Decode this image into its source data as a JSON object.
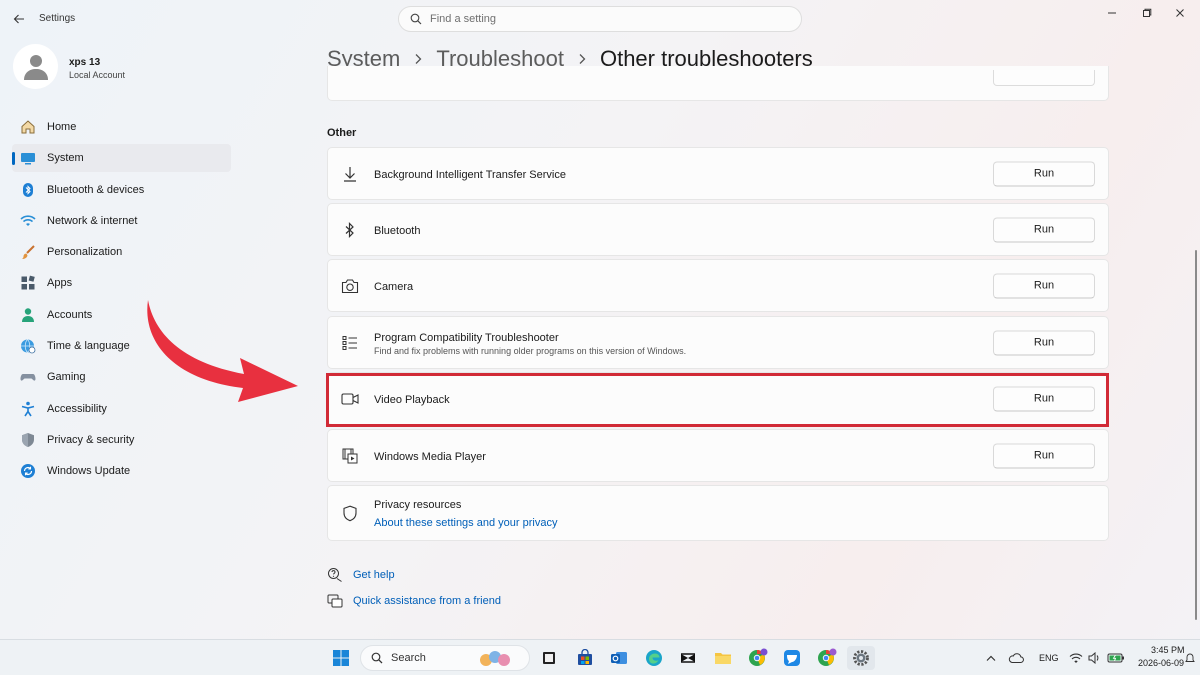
{
  "window": {
    "title": "Settings",
    "controls": [
      "minimize-icon",
      "maximize-icon",
      "close-icon"
    ]
  },
  "search": {
    "placeholder": "Find a setting"
  },
  "profile": {
    "name": "xps 13",
    "account_type": "Local Account"
  },
  "sidebar": {
    "items": [
      {
        "label": "Home",
        "icon": "home-icon"
      },
      {
        "label": "System",
        "icon": "system-icon",
        "active": true
      },
      {
        "label": "Bluetooth & devices",
        "icon": "bluetooth-devices-icon"
      },
      {
        "label": "Network & internet",
        "icon": "wifi-icon"
      },
      {
        "label": "Personalization",
        "icon": "brush-icon"
      },
      {
        "label": "Apps",
        "icon": "apps-icon"
      },
      {
        "label": "Accounts",
        "icon": "accounts-icon"
      },
      {
        "label": "Time & language",
        "icon": "globe-clock-icon"
      },
      {
        "label": "Gaming",
        "icon": "controller-icon"
      },
      {
        "label": "Accessibility",
        "icon": "accessibility-icon"
      },
      {
        "label": "Privacy & security",
        "icon": "shield-icon"
      },
      {
        "label": "Windows Update",
        "icon": "update-icon"
      }
    ]
  },
  "breadcrumb": {
    "items": [
      "System",
      "Troubleshoot"
    ],
    "current": "Other troubleshooters"
  },
  "section": {
    "title": "Other"
  },
  "troubleshooters": [
    {
      "label": "Background Intelligent Transfer Service",
      "icon": "download-icon",
      "button": "Run"
    },
    {
      "label": "Bluetooth",
      "icon": "bluetooth-icon",
      "button": "Run"
    },
    {
      "label": "Camera",
      "icon": "camera-icon",
      "button": "Run"
    },
    {
      "label": "Program Compatibility Troubleshooter",
      "description": "Find and fix problems with running older programs on this version of Windows.",
      "icon": "list-icon",
      "button": "Run"
    },
    {
      "label": "Video Playback",
      "icon": "video-camera-icon",
      "button": "Run",
      "highlighted": true
    },
    {
      "label": "Windows Media Player",
      "icon": "media-player-icon",
      "button": "Run"
    }
  ],
  "privacy": {
    "title": "Privacy resources",
    "link": "About these settings and your privacy"
  },
  "help": {
    "get_help": "Get help",
    "quick_assist": "Quick assistance from a friend"
  },
  "taskbar": {
    "search_label": "Search",
    "language": "ENG",
    "time": "3:45 PM",
    "date": "2026-06-09"
  },
  "colors": {
    "accent": "#0067c0",
    "link": "#005fb8",
    "highlight": "#d12a36",
    "arrow": "#e8303f"
  }
}
